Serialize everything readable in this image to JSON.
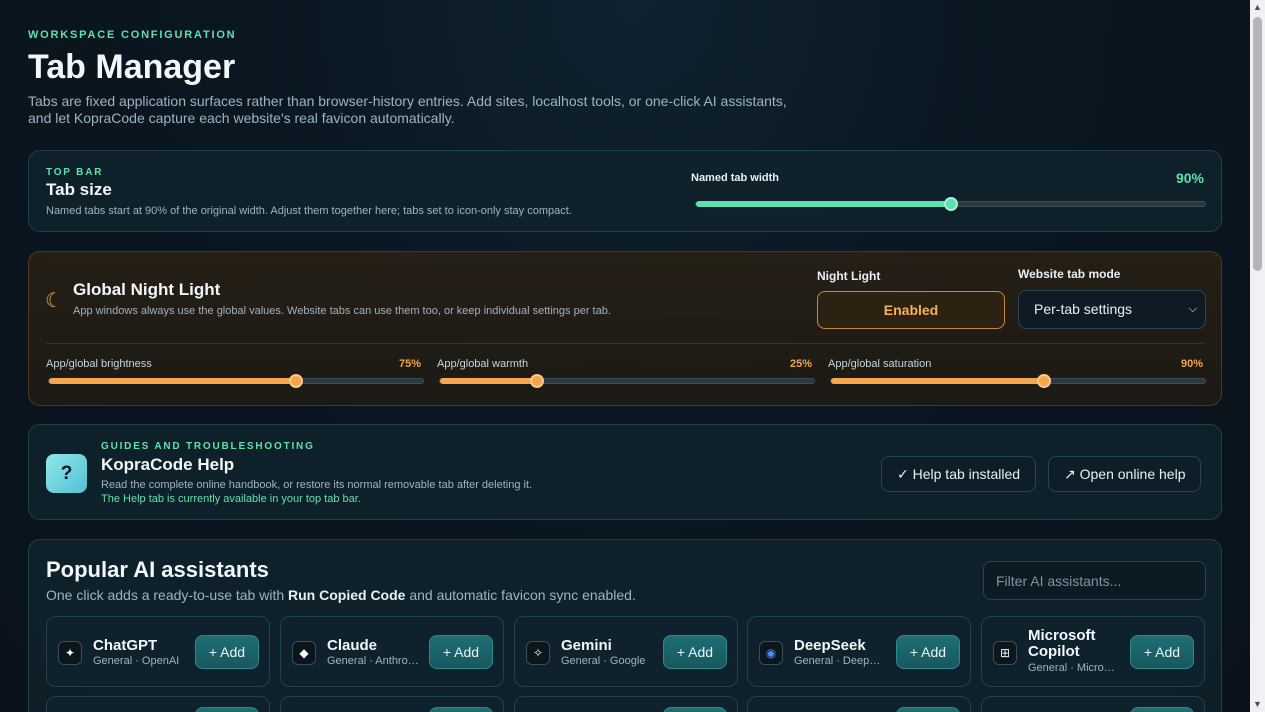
{
  "header": {
    "eyebrow": "WORKSPACE CONFIGURATION",
    "title": "Tab Manager",
    "description": "Tabs are fixed application surfaces rather than browser-history entries. Add sites, localhost tools, or one-click AI assistants, and let KopraCode capture each website's real favicon automatically."
  },
  "tab_size": {
    "eyebrow": "TOP BAR",
    "title": "Tab size",
    "subtitle": "Named tabs start at 90% of the original width. Adjust them together here; tabs set to icon-only stay compact.",
    "slider_label": "Named tab width",
    "slider_value_text": "90%",
    "slider_level": 0.5,
    "accent": "#5fe0b0"
  },
  "night_light": {
    "icon": "moon-icon",
    "title": "Global Night Light",
    "subtitle": "App windows always use the global values. Website tabs can use them too, or keep individual settings per tab.",
    "toggle_label": "Night Light",
    "toggle_value": "Enabled",
    "mode_label": "Website tab mode",
    "mode_value": "Per-tab settings",
    "accent": "#f5a54a",
    "sliders": [
      {
        "label": "App/global brightness",
        "value_text": "75%",
        "level": 0.66
      },
      {
        "label": "App/global warmth",
        "value_text": "25%",
        "level": 0.26
      },
      {
        "label": "App/global saturation",
        "value_text": "90%",
        "level": 0.57
      }
    ]
  },
  "help": {
    "eyebrow": "GUIDES AND TROUBLESHOOTING",
    "title": "KopraCode Help",
    "subtitle": "Read the complete online handbook, or restore its normal removable tab after deleting it.",
    "status": "The Help tab is currently available in your top tab bar.",
    "icon_glyph": "?",
    "installed_label": "✓ Help tab installed",
    "online_label": "↗ Open online help"
  },
  "ai": {
    "title": "Popular AI assistants",
    "subtitle_pre": "One click adds a ready-to-use tab with ",
    "subtitle_bold": "Run Copied Code",
    "subtitle_post": " and automatic favicon sync enabled.",
    "filter_placeholder": "Filter AI assistants...",
    "assistants": [
      {
        "name": "ChatGPT",
        "meta": "General · OpenAI",
        "glyph": "✦",
        "icon": "chatgpt-icon",
        "add": "+ Add"
      },
      {
        "name": "Claude",
        "meta": "General · Anthropic",
        "glyph": "◆",
        "icon": "claude-icon",
        "add": "+ Add"
      },
      {
        "name": "Gemini",
        "meta": "General · Google",
        "glyph": "✧",
        "icon": "gemini-icon",
        "add": "+ Add"
      },
      {
        "name": "DeepSeek",
        "meta": "General · DeepSeek",
        "glyph": "◉",
        "icon": "deepseek-icon",
        "add": "+ Add"
      },
      {
        "name": "Microsoft Copilot",
        "meta": "General · Microsoft",
        "glyph": "⊞",
        "icon": "copilot-icon",
        "add": "+ Add"
      }
    ]
  }
}
